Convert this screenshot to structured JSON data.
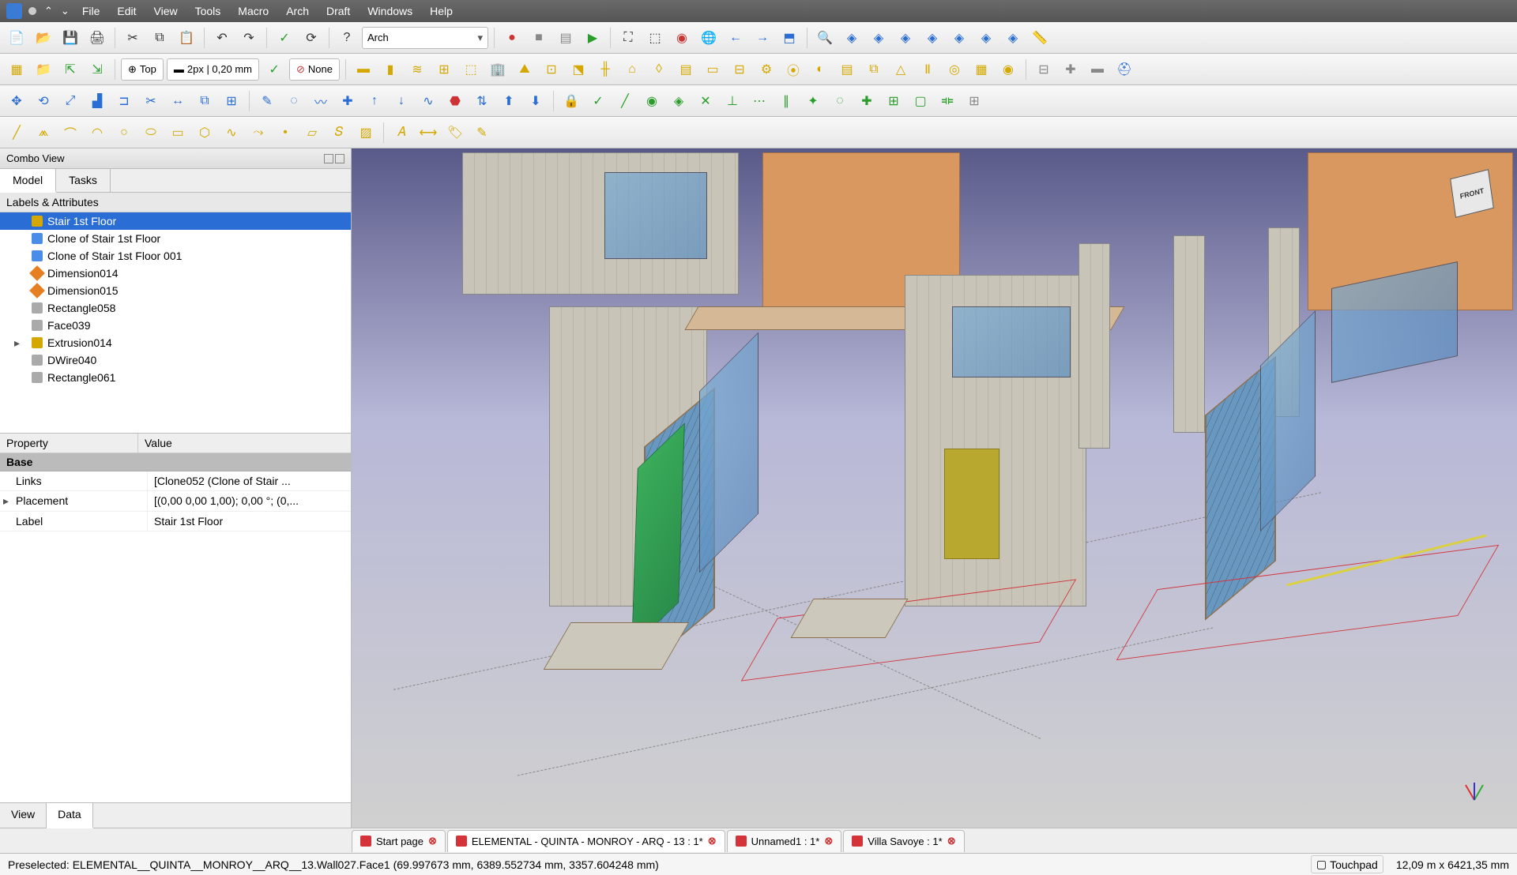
{
  "menu": {
    "items": [
      "File",
      "Edit",
      "View",
      "Tools",
      "Macro",
      "Arch",
      "Draft",
      "Windows",
      "Help"
    ]
  },
  "workbench": {
    "current": "Arch"
  },
  "style": {
    "top": "Top",
    "line": "2px | 0,20 mm",
    "none": "None"
  },
  "combo": {
    "title": "Combo View",
    "tabs": {
      "model": "Model",
      "tasks": "Tasks"
    },
    "header": "Labels & Attributes"
  },
  "tree": [
    {
      "label": "Stair 1st Floor",
      "icon": "yellow",
      "selected": true
    },
    {
      "label": "Clone of Stair 1st Floor",
      "icon": "blue"
    },
    {
      "label": "Clone of Stair 1st Floor 001",
      "icon": "blue"
    },
    {
      "label": "Dimension014",
      "icon": "orange"
    },
    {
      "label": "Dimension015",
      "icon": "orange"
    },
    {
      "label": "Rectangle058",
      "icon": "gray"
    },
    {
      "label": "Face039",
      "icon": "gray"
    },
    {
      "label": "Extrusion014",
      "icon": "yellow",
      "expandable": true
    },
    {
      "label": "DWire040",
      "icon": "gray"
    },
    {
      "label": "Rectangle061",
      "icon": "gray"
    }
  ],
  "props": {
    "col1": "Property",
    "col2": "Value",
    "group": "Base",
    "rows": [
      {
        "name": "Links",
        "value": "[Clone052 (Clone of Stair ..."
      },
      {
        "name": "Placement",
        "value": "[(0,00 0,00 1,00); 0,00 °; (0,..."
      },
      {
        "name": "Label",
        "value": "Stair 1st Floor"
      }
    ]
  },
  "bottom_tabs": {
    "view": "View",
    "data": "Data"
  },
  "doctabs": [
    {
      "label": "Start page",
      "active": false
    },
    {
      "label": "ELEMENTAL - QUINTA - MONROY - ARQ - 13 : 1*",
      "active": true
    },
    {
      "label": "Unnamed1 : 1*",
      "active": false
    },
    {
      "label": "Villa Savoye : 1*",
      "active": false
    }
  ],
  "status": {
    "preselect": "Preselected: ELEMENTAL__QUINTA__MONROY__ARQ__13.Wall027.Face1 (69.997673 mm, 6389.552734 mm, 3357.604248 mm)",
    "nav": "Touchpad",
    "dims": "12,09 m x 6421,35 mm"
  },
  "navcube": {
    "face": "FRONT"
  }
}
